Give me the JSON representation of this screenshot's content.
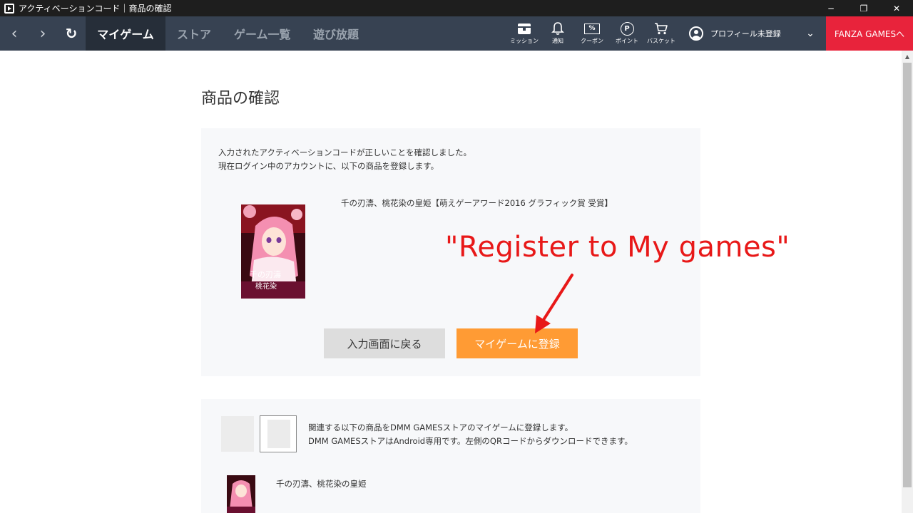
{
  "window": {
    "title": "アクティベーションコード｜商品の確認",
    "buttons": {
      "minimize": "─",
      "maximize": "❐",
      "close": "✕"
    }
  },
  "nav": {
    "back": "‹",
    "forward": "›",
    "reload": "↻",
    "tabs": [
      {
        "label": "マイゲーム",
        "active": true
      },
      {
        "label": "ストア",
        "active": false
      },
      {
        "label": "ゲーム一覧",
        "active": false
      },
      {
        "label": "遊び放題",
        "active": false
      }
    ],
    "icons": [
      {
        "label": "ミッション",
        "icon": "mission-icon"
      },
      {
        "label": "通知",
        "icon": "bell-icon"
      },
      {
        "label": "クーポン",
        "icon": "coupon-icon",
        "glyph": "%"
      },
      {
        "label": "ポイント",
        "icon": "point-icon",
        "glyph": "P"
      },
      {
        "label": "バスケット",
        "icon": "cart-icon"
      }
    ],
    "profile_label": "プロフィール未登録",
    "chevron": "⌄",
    "fanza_label": "FANZA GAMESへ"
  },
  "page": {
    "title": "商品の確認",
    "message_line1": "入力されたアクティベーションコードが正しいことを確認しました。",
    "message_line2": "現在ログイン中のアカウントに、以下の商品を登録します。",
    "product_title": "千の刃濤、桃花染の皇姫【萌えゲーアワード2016 グラフィック賞 受賞】",
    "back_button": "入力画面に戻る",
    "register_button": "マイゲームに登録",
    "related_line1": "関連する以下の商品をDMM GAMESストアのマイゲームに登録します。",
    "related_line2": "DMM GAMESストアはAndroid専用です。左側のQRコードからダウンロードできます。",
    "related_product_title": "千の刃濤、桃花染の皇姫"
  },
  "annotation": {
    "text": "\"Register to My games\"",
    "color": "#e81818"
  },
  "colors": {
    "navbar": "#374252",
    "active_tab": "#262e39",
    "fanza": "#e8233b",
    "register": "#ff9b34",
    "back": "#dddddd",
    "panel": "#f7f8fa"
  }
}
